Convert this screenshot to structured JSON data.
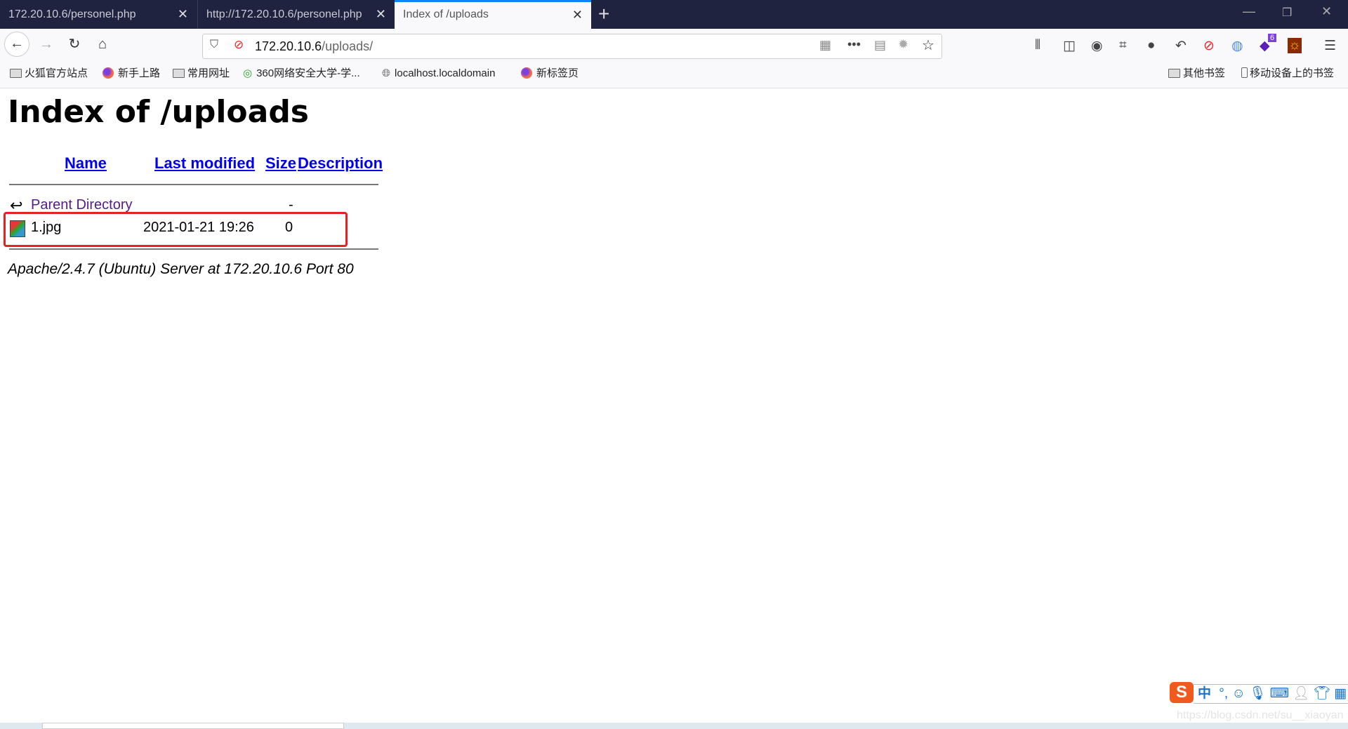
{
  "tabs": [
    {
      "label": "172.20.10.6/personel.php"
    },
    {
      "label": "http://172.20.10.6/personel.php"
    },
    {
      "label": "Index of /uploads",
      "active": true
    }
  ],
  "url": {
    "host": "172.20.10.6",
    "path": "/uploads/"
  },
  "extension_badge": "6",
  "bookmarks": [
    {
      "label": "火狐官方站点",
      "icon": "folder-icon"
    },
    {
      "label": "新手上路",
      "icon": "firefox-icon"
    },
    {
      "label": "常用网址",
      "icon": "folder-icon"
    },
    {
      "label": "360网络安全大学-学...",
      "icon": "360-icon"
    },
    {
      "label": "localhost.localdomain",
      "icon": "globe-icon"
    },
    {
      "label": "新标签页",
      "icon": "firefox-icon"
    }
  ],
  "bookmarks_right": [
    {
      "label": "其他书签"
    },
    {
      "label": "移动设备上的书签"
    }
  ],
  "page": {
    "title": "Index of /uploads",
    "columns": {
      "name": "Name",
      "modified": "Last modified",
      "size": "Size",
      "description": "Description"
    },
    "rows": [
      {
        "name": "Parent Directory",
        "modified": "",
        "size": "-"
      },
      {
        "name": "1.jpg",
        "modified": "2021-01-21 19:26",
        "size": "0"
      }
    ],
    "footer": "Apache/2.4.7 (Ubuntu) Server at 172.20.10.6 Port 80"
  },
  "ime": {
    "lang": "中",
    "punct": "°,"
  },
  "watermark": "https://blog.csdn.net/su__xiaoyan",
  "colors": {
    "tabbar": "#1f2340",
    "accent": "#0a84ff",
    "highlight": "#e82020",
    "link": "#0000ee",
    "visited": "#551a8b"
  }
}
